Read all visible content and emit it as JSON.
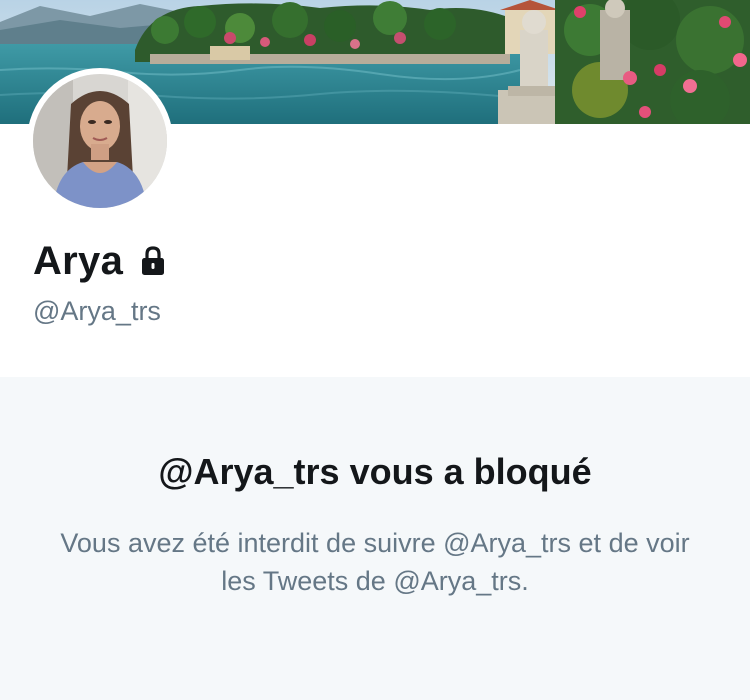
{
  "profile": {
    "name": "Arya",
    "handle": "@Arya_trs",
    "protected_icon": "lock-icon",
    "banner_image": "lakeside-villa-garden-banner",
    "avatar_image": "user-avatar-photo"
  },
  "blocked": {
    "title": "@Arya_trs vous a bloqué",
    "message": "Vous avez été interdit de suivre @Arya_trs et de voir les Tweets de @Arya_trs."
  },
  "colors": {
    "primary_text": "#14171a",
    "secondary_text": "#657786",
    "blocked_background": "#f5f8fa"
  }
}
